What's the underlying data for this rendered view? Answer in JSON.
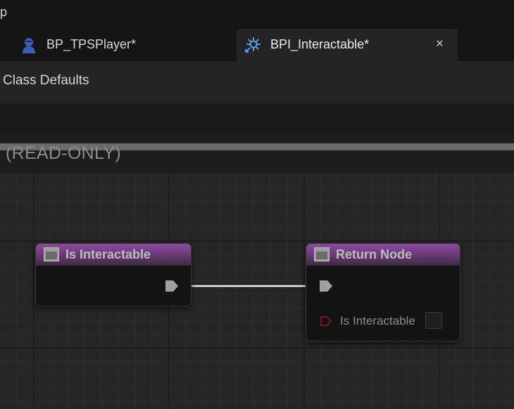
{
  "menu": {
    "fragment": "p"
  },
  "tabs": [
    {
      "label": "BP_TPSPlayer*",
      "icon": "player-pawn-icon",
      "active": false
    },
    {
      "label": "BPI_Interactable*",
      "icon": "blueprint-interface-icon",
      "active": true,
      "close": "×"
    }
  ],
  "toolbar": {
    "class_defaults_label": "Class Defaults"
  },
  "graph": {
    "read_only_label": "(READ-ONLY)",
    "nodes": [
      {
        "title": "Is Interactable",
        "icon": "function-icon"
      },
      {
        "title": "Return Node",
        "icon": "function-icon",
        "output_pin_label": "Is Interactable"
      }
    ]
  },
  "colors": {
    "node_header": "#8e4aa0",
    "exec_pin": "#a0a0a0",
    "bool_pin": "#8b1a1a",
    "active_tab": "#242424",
    "wire": "#f0f0f0"
  }
}
